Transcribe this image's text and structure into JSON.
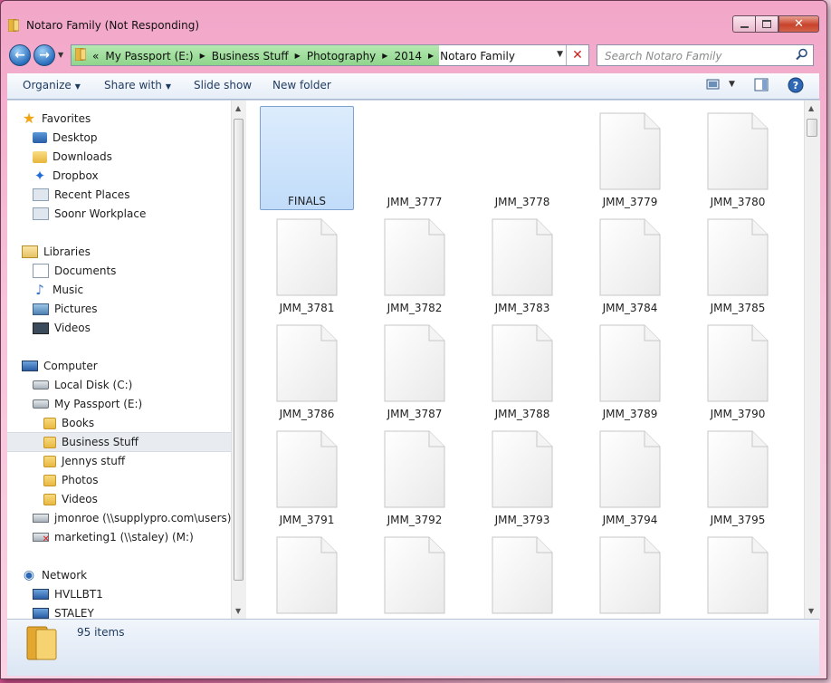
{
  "window": {
    "title": "Notaro Family (Not Responding)"
  },
  "address": {
    "chevron": "«",
    "crumbs": [
      "My Passport (E:)",
      "Business Stuff",
      "Photography",
      "2014",
      "Notaro Family"
    ],
    "search_placeholder": "Search Notaro Family"
  },
  "toolbar": {
    "organize": "Organize",
    "share_with": "Share with",
    "slide_show": "Slide show",
    "new_folder": "New folder"
  },
  "sidebar": {
    "favorites": {
      "header": "Favorites",
      "items": [
        "Desktop",
        "Downloads",
        "Dropbox",
        "Recent Places",
        "Soonr Workplace"
      ]
    },
    "libraries": {
      "header": "Libraries",
      "items": [
        "Documents",
        "Music",
        "Pictures",
        "Videos"
      ]
    },
    "computer": {
      "header": "Computer",
      "items": [
        "Local Disk (C:)",
        "My Passport (E:)"
      ],
      "subfolders": [
        "Books",
        "Business Stuff",
        "Jennys stuff",
        "Photos",
        "Videos"
      ],
      "selected": "Business Stuff",
      "network_drives": [
        "jmonroe (\\\\supplypro.com\\users) (H:)",
        "marketing1 (\\\\staley) (M:)"
      ]
    },
    "network": {
      "header": "Network",
      "items": [
        "HVLLBT1",
        "STALEY"
      ]
    }
  },
  "files": [
    {
      "name": "FINALS",
      "type": "folder",
      "selected": true
    },
    {
      "name": "JMM_3777",
      "type": "blank"
    },
    {
      "name": "JMM_3778",
      "type": "blank"
    },
    {
      "name": "JMM_3779",
      "type": "file"
    },
    {
      "name": "JMM_3780",
      "type": "file"
    },
    {
      "name": "JMM_3781",
      "type": "file"
    },
    {
      "name": "JMM_3782",
      "type": "file"
    },
    {
      "name": "JMM_3783",
      "type": "file"
    },
    {
      "name": "JMM_3784",
      "type": "file"
    },
    {
      "name": "JMM_3785",
      "type": "file"
    },
    {
      "name": "JMM_3786",
      "type": "file"
    },
    {
      "name": "JMM_3787",
      "type": "file"
    },
    {
      "name": "JMM_3788",
      "type": "file"
    },
    {
      "name": "JMM_3789",
      "type": "file"
    },
    {
      "name": "JMM_3790",
      "type": "file"
    },
    {
      "name": "JMM_3791",
      "type": "file"
    },
    {
      "name": "JMM_3792",
      "type": "file"
    },
    {
      "name": "JMM_3793",
      "type": "file"
    },
    {
      "name": "JMM_3794",
      "type": "file"
    },
    {
      "name": "JMM_3795",
      "type": "file"
    },
    {
      "name": "",
      "type": "file"
    },
    {
      "name": "",
      "type": "file"
    },
    {
      "name": "",
      "type": "file"
    },
    {
      "name": "",
      "type": "file"
    },
    {
      "name": "",
      "type": "file"
    }
  ],
  "status": {
    "item_count": "95 items"
  },
  "colors": {
    "selection": "#cce2fa",
    "accent": "#1e3a5f"
  }
}
